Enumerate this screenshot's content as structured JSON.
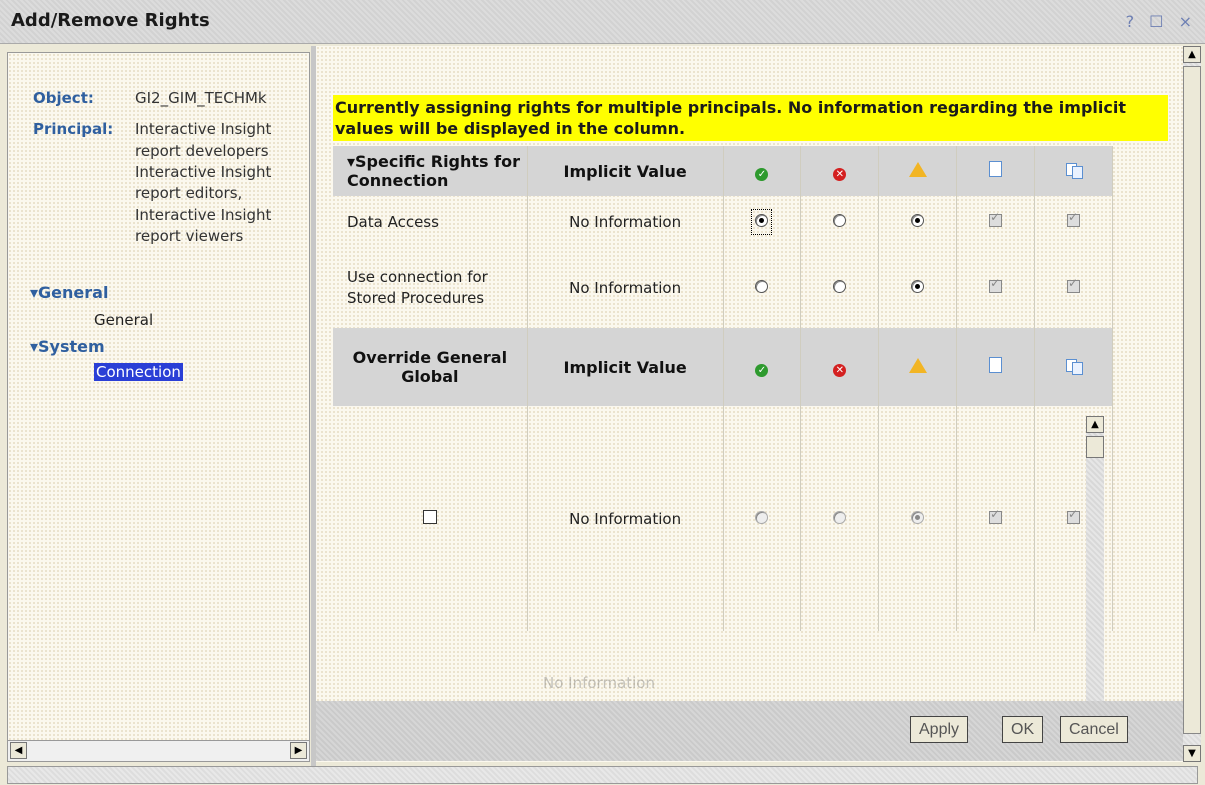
{
  "window": {
    "title": "Add/Remove Rights",
    "controls": [
      "?",
      "☐",
      "×"
    ]
  },
  "left": {
    "object_label": "Object:",
    "object_value": "GI2_GIM_TECHMk",
    "principal_label": "Principal:",
    "principals": [
      "Interactive Insight",
      "report developers",
      "Interactive Insight",
      "report editors,",
      "Interactive Insight",
      "report viewers"
    ],
    "tree": [
      {
        "head": "▾General",
        "item": "General"
      },
      {
        "head": "▾System",
        "item": "Connection"
      }
    ]
  },
  "banner": "Currently assigning rights for multiple principals. No information regarding the implicit values will be displayed in the column.",
  "table": {
    "section1_header": "▾Specific Rights for Connection",
    "implicit_header": "Implicit Value",
    "rows": [
      {
        "name": "Data Access",
        "implicit": "No Information",
        "radios": [
          true,
          false,
          true
        ],
        "checks": [
          true,
          true
        ]
      },
      {
        "name": "Use connection for Stored Procedures",
        "implicit": "No Information",
        "radios": [
          false,
          false,
          true
        ],
        "checks": [
          true,
          true
        ]
      }
    ],
    "section2_header": "Override General Global",
    "section2_rows": [
      {
        "implicit": "No Information"
      },
      {
        "implicit": "No Information"
      }
    ]
  },
  "buttons": {
    "apply": "Apply",
    "ok": "OK",
    "cancel": "Cancel"
  }
}
